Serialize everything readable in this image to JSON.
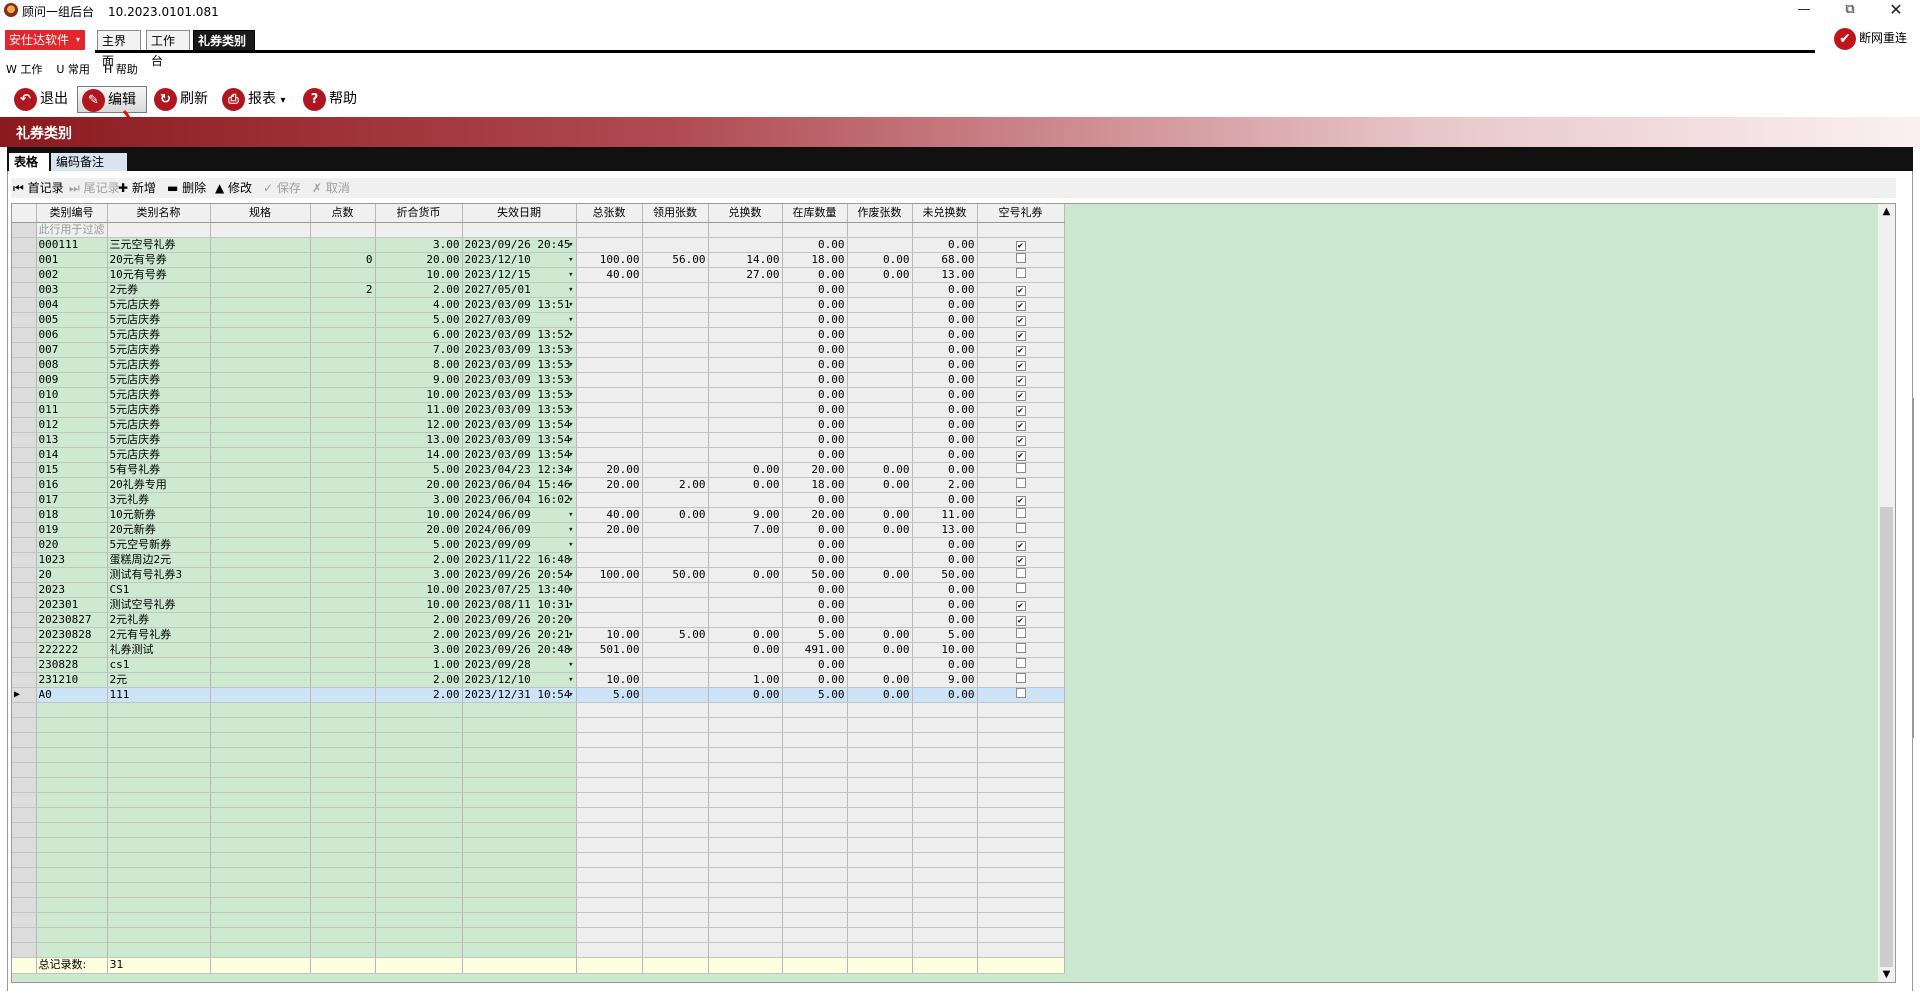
{
  "window": {
    "title": "顾问一组后台",
    "version": "10.2023.0101.081",
    "min_icon": "minimize-icon",
    "max_icon": "restore-icon",
    "close_icon": "close-icon"
  },
  "brand": {
    "label": "安仕达软件",
    "caret": "▾"
  },
  "page_tabs": [
    {
      "label": "主界面"
    },
    {
      "label": "工作台"
    },
    {
      "label": "礼券类别"
    }
  ],
  "reconnect": {
    "label": "断网重连",
    "icon": "✔"
  },
  "menu": [
    {
      "label": "W 工作"
    },
    {
      "label": "U 常用"
    },
    {
      "label": "H 帮助"
    }
  ],
  "toolbar": {
    "exit": "退出",
    "edit": "编辑",
    "refresh": "刷新",
    "report": "报表",
    "report_caret": "▾",
    "help": "帮助"
  },
  "panel": {
    "title": "礼券类别"
  },
  "inner_tabs": [
    {
      "label": "表格"
    },
    {
      "label": "编码备注"
    }
  ],
  "navigator": {
    "first": "首记录",
    "last": "尾记录",
    "add": "新增",
    "delete": "删除",
    "modify": "修改",
    "save": "保存",
    "cancel": "取消"
  },
  "grid": {
    "columns": [
      "类别编号",
      "类别名称",
      "规格",
      "点数",
      "折合货币",
      "失效日期",
      "总张数",
      "领用张数",
      "兑换数",
      "在库数量",
      "作废张数",
      "未兑换数",
      "空号礼券"
    ],
    "filter_hint": "此行用于过滤",
    "rows": [
      [
        "000111",
        "三元空号礼券",
        "",
        "",
        "3.00",
        "2023/09/26 20:45",
        "",
        "",
        "",
        "0.00",
        "",
        "0.00",
        "✔"
      ],
      [
        "001",
        "20元有号券",
        "",
        "0",
        "20.00",
        "2023/12/10",
        "100.00",
        "56.00",
        "14.00",
        "18.00",
        "0.00",
        "68.00",
        ""
      ],
      [
        "002",
        "10元有号券",
        "",
        "",
        "10.00",
        "2023/12/15",
        "40.00",
        "",
        "27.00",
        "0.00",
        "0.00",
        "13.00",
        ""
      ],
      [
        "003",
        "2元券",
        "",
        "2",
        "2.00",
        "2027/05/01",
        "",
        "",
        "",
        "0.00",
        "",
        "0.00",
        "✔"
      ],
      [
        "004",
        "5元店庆券",
        "",
        "",
        "4.00",
        "2023/03/09 13:51",
        "",
        "",
        "",
        "0.00",
        "",
        "0.00",
        "✔"
      ],
      [
        "005",
        "5元店庆券",
        "",
        "",
        "5.00",
        "2027/03/09",
        "",
        "",
        "",
        "0.00",
        "",
        "0.00",
        "✔"
      ],
      [
        "006",
        "5元店庆券",
        "",
        "",
        "6.00",
        "2023/03/09 13:52",
        "",
        "",
        "",
        "0.00",
        "",
        "0.00",
        "✔"
      ],
      [
        "007",
        "5元店庆券",
        "",
        "",
        "7.00",
        "2023/03/09 13:53",
        "",
        "",
        "",
        "0.00",
        "",
        "0.00",
        "✔"
      ],
      [
        "008",
        "5元店庆券",
        "",
        "",
        "8.00",
        "2023/03/09 13:53",
        "",
        "",
        "",
        "0.00",
        "",
        "0.00",
        "✔"
      ],
      [
        "009",
        "5元店庆券",
        "",
        "",
        "9.00",
        "2023/03/09 13:53",
        "",
        "",
        "",
        "0.00",
        "",
        "0.00",
        "✔"
      ],
      [
        "010",
        "5元店庆券",
        "",
        "",
        "10.00",
        "2023/03/09 13:53",
        "",
        "",
        "",
        "0.00",
        "",
        "0.00",
        "✔"
      ],
      [
        "011",
        "5元店庆券",
        "",
        "",
        "11.00",
        "2023/03/09 13:53",
        "",
        "",
        "",
        "0.00",
        "",
        "0.00",
        "✔"
      ],
      [
        "012",
        "5元店庆券",
        "",
        "",
        "12.00",
        "2023/03/09 13:54",
        "",
        "",
        "",
        "0.00",
        "",
        "0.00",
        "✔"
      ],
      [
        "013",
        "5元店庆券",
        "",
        "",
        "13.00",
        "2023/03/09 13:54",
        "",
        "",
        "",
        "0.00",
        "",
        "0.00",
        "✔"
      ],
      [
        "014",
        "5元店庆券",
        "",
        "",
        "14.00",
        "2023/03/09 13:54",
        "",
        "",
        "",
        "0.00",
        "",
        "0.00",
        "✔"
      ],
      [
        "015",
        "5有号礼券",
        "",
        "",
        "5.00",
        "2023/04/23 12:34",
        "20.00",
        "",
        "0.00",
        "20.00",
        "0.00",
        "0.00",
        ""
      ],
      [
        "016",
        "20礼券专用",
        "",
        "",
        "20.00",
        "2023/06/04 15:46",
        "20.00",
        "2.00",
        "0.00",
        "18.00",
        "0.00",
        "2.00",
        ""
      ],
      [
        "017",
        "3元礼券",
        "",
        "",
        "3.00",
        "2023/06/04 16:02",
        "",
        "",
        "",
        "0.00",
        "",
        "0.00",
        "✔"
      ],
      [
        "018",
        "10元新券",
        "",
        "",
        "10.00",
        "2024/06/09",
        "40.00",
        "0.00",
        "9.00",
        "20.00",
        "0.00",
        "11.00",
        ""
      ],
      [
        "019",
        "20元新券",
        "",
        "",
        "20.00",
        "2024/06/09",
        "20.00",
        "",
        "7.00",
        "0.00",
        "0.00",
        "13.00",
        ""
      ],
      [
        "020",
        "5元空号新券",
        "",
        "",
        "5.00",
        "2023/09/09",
        "",
        "",
        "",
        "0.00",
        "",
        "0.00",
        "✔"
      ],
      [
        "1023",
        "蛋糕周边2元",
        "",
        "",
        "2.00",
        "2023/11/22 16:48",
        "",
        "",
        "",
        "0.00",
        "",
        "0.00",
        "✔"
      ],
      [
        "20",
        "测试有号礼券3",
        "",
        "",
        "3.00",
        "2023/09/26 20:54",
        "100.00",
        "50.00",
        "0.00",
        "50.00",
        "0.00",
        "50.00",
        ""
      ],
      [
        "2023",
        "CS1",
        "",
        "",
        "10.00",
        "2023/07/25 13:40",
        "",
        "",
        "",
        "0.00",
        "",
        "0.00",
        ""
      ],
      [
        "202301",
        "测试空号礼券",
        "",
        "",
        "10.00",
        "2023/08/11 10:31",
        "",
        "",
        "",
        "0.00",
        "",
        "0.00",
        "✔"
      ],
      [
        "20230827",
        "2元礼券",
        "",
        "",
        "2.00",
        "2023/09/26 20:20",
        "",
        "",
        "",
        "0.00",
        "",
        "0.00",
        "✔"
      ],
      [
        "20230828",
        "2元有号礼券",
        "",
        "",
        "2.00",
        "2023/09/26 20:21",
        "10.00",
        "5.00",
        "0.00",
        "5.00",
        "0.00",
        "5.00",
        ""
      ],
      [
        "222222",
        "礼券测试",
        "",
        "",
        "3.00",
        "2023/09/26 20:48",
        "501.00",
        "",
        "0.00",
        "491.00",
        "0.00",
        "10.00",
        ""
      ],
      [
        "230828",
        "cs1",
        "",
        "",
        "1.00",
        "2023/09/28",
        "",
        "",
        "",
        "0.00",
        "",
        "0.00",
        ""
      ],
      [
        "231210",
        "2元",
        "",
        "",
        "2.00",
        "2023/12/10",
        "10.00",
        "",
        "1.00",
        "0.00",
        "0.00",
        "9.00",
        ""
      ],
      [
        "A0",
        "111",
        "",
        "",
        "2.00",
        "2023/12/31 10:54",
        "5.00",
        "",
        "0.00",
        "5.00",
        "0.00",
        "0.00",
        ""
      ]
    ],
    "selected_row_marker": "▶",
    "footer_label": "总记录数:",
    "footer_count": "31"
  }
}
